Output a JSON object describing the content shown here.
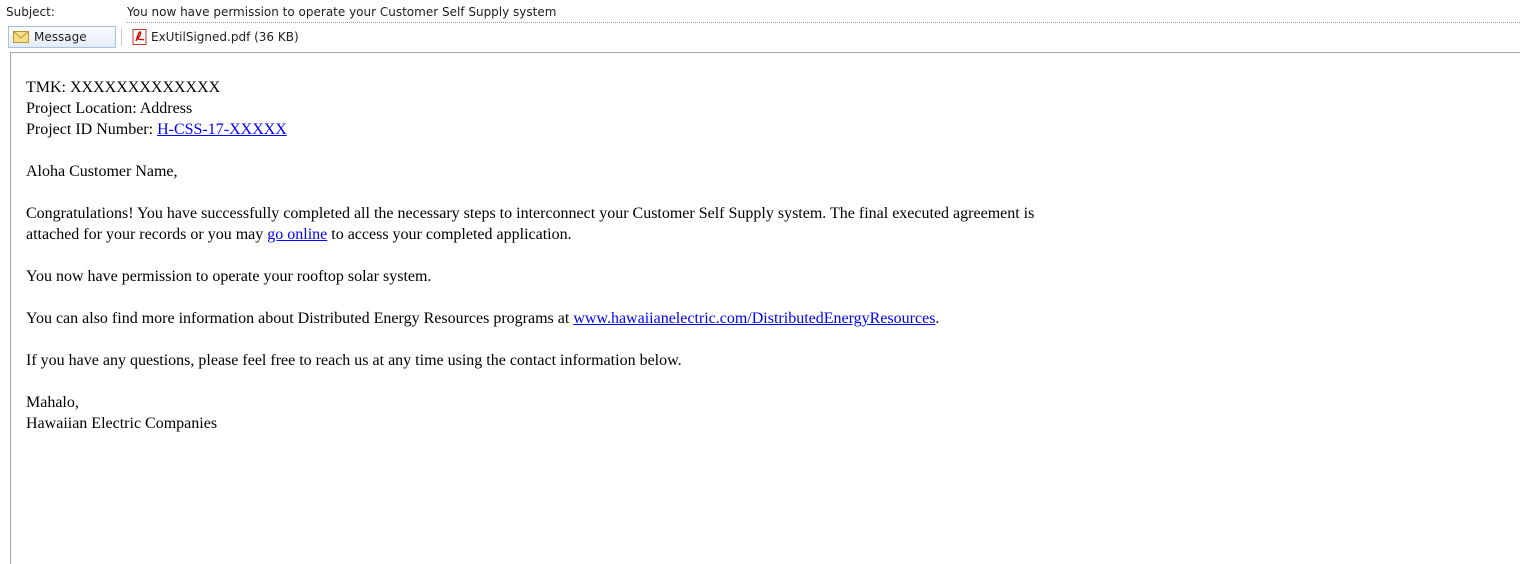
{
  "header": {
    "subject_label": "Subject:",
    "subject_value": "You now have permission to operate your Customer Self Supply system"
  },
  "attachments": {
    "message_label": "Message",
    "message_icon": "envelope-icon",
    "pdf_label": "ExUtilSigned.pdf (36 KB)",
    "pdf_icon": "pdf-icon",
    "accent": "#a8c0df"
  },
  "body": {
    "tmk": "TMK: XXXXXXXXXXXXX",
    "location": "Project Location: Address",
    "project_id_label": "Project ID Number: ",
    "project_id_link": "H-CSS-17-XXXXX",
    "greeting": "Aloha Customer Name,",
    "congrats_line1": "Congratulations! You have successfully completed all the necessary steps to interconnect your Customer Self Supply system. The final executed agreement is",
    "congrats_line2_pre": "attached for your records or you may ",
    "congrats_link": "go online",
    "congrats_line2_post": " to access your completed application.",
    "permission": "You now have permission to operate your rooftop solar system.",
    "info_pre": "You can also find more information about Distributed Energy Resources programs at ",
    "info_link": "www.hawaiianelectric.com/DistributedEnergyResources",
    "info_post": ".",
    "questions": "If you have any questions, please feel free to reach us at any time using the contact information below.",
    "signoff": "Mahalo,",
    "signature": "Hawaiian Electric Companies",
    "link_color": "#0000ff"
  }
}
